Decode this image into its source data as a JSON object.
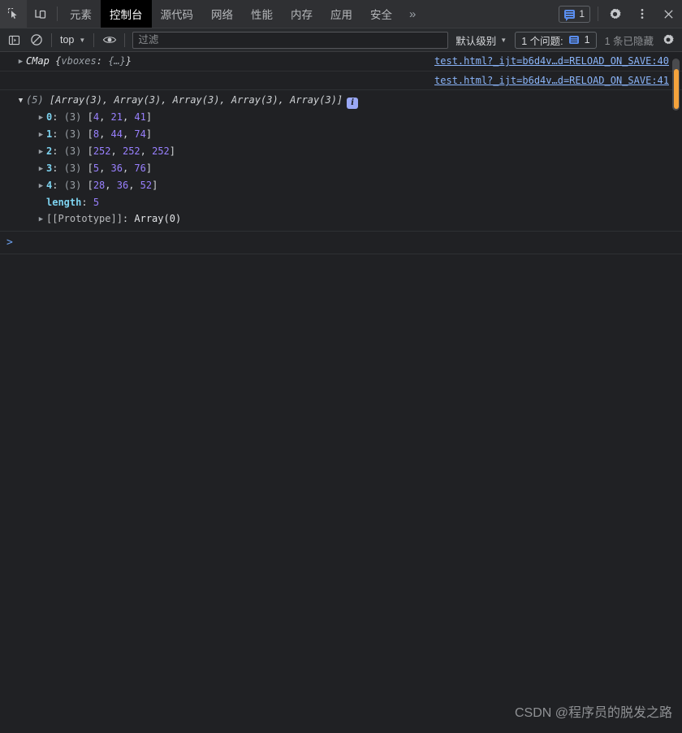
{
  "tabbar": {
    "inspect_icon": "inspect-element-icon",
    "device_icon": "device-toolbar-icon",
    "tabs": [
      {
        "label": "元素",
        "active": false
      },
      {
        "label": "控制台",
        "active": true
      },
      {
        "label": "源代码",
        "active": false
      },
      {
        "label": "网络",
        "active": false
      },
      {
        "label": "性能",
        "active": false
      },
      {
        "label": "内存",
        "active": false
      },
      {
        "label": "应用",
        "active": false
      },
      {
        "label": "安全",
        "active": false
      }
    ],
    "more_tabs": "»",
    "issues_count": "1",
    "settings_icon": "gear-icon",
    "more_icon": "kebab-menu-icon",
    "close_icon": "close-icon"
  },
  "toolbar": {
    "sidebar_icon": "console-sidebar-icon",
    "clear_icon": "clear-console-icon",
    "context": "top",
    "context_caret": "▼",
    "eye_icon": "live-expression-eye-icon",
    "filter_placeholder": "过滤",
    "filter_value": "",
    "level_label": "默认级别",
    "level_caret": "▼",
    "issue_label": "1 个问题:",
    "issue_count": "1",
    "hidden_label": "1 条已隐藏",
    "settings_icon": "console-settings-gear-icon"
  },
  "console": {
    "rows": [
      {
        "arrow": "▶",
        "name": "CMap",
        "brace_open": "{",
        "prop": "vboxes",
        "prop_sep": ": ",
        "prop_val": "{…}",
        "brace_close": "}",
        "source": "test.html?_ijt=b6d4v…d=RELOAD_ON_SAVE:40"
      },
      {
        "arrow": "",
        "source": "test.html?_ijt=b6d4v…d=RELOAD_ON_SAVE:41"
      }
    ],
    "array_header": {
      "arrow": "▼",
      "count": "(5)",
      "summary": "[Array(3), Array(3), Array(3), Array(3), Array(3)]",
      "info_badge": "i"
    },
    "array_items": [
      {
        "arrow": "▶",
        "key": "0",
        "len": "(3)",
        "values": [
          4,
          21,
          41
        ]
      },
      {
        "arrow": "▶",
        "key": "1",
        "len": "(3)",
        "values": [
          8,
          44,
          74
        ]
      },
      {
        "arrow": "▶",
        "key": "2",
        "len": "(3)",
        "values": [
          252,
          252,
          252
        ]
      },
      {
        "arrow": "▶",
        "key": "3",
        "len": "(3)",
        "values": [
          5,
          36,
          76
        ]
      },
      {
        "arrow": "▶",
        "key": "4",
        "len": "(3)",
        "values": [
          28,
          36,
          52
        ]
      }
    ],
    "length_key": "length",
    "length_value": "5",
    "proto_arrow": "▶",
    "proto_key": "[[Prototype]]",
    "proto_value": "Array(0)",
    "prompt_chevron": ">",
    "prompt_value": ""
  },
  "watermark": "CSDN @程序员的脱发之路",
  "colors": {
    "accent_blue": "#8ab4f8",
    "number_purple": "#9980ff",
    "key_cyan": "#7dd3f0",
    "warn_orange": "#f5a33c",
    "bg": "#202124",
    "toolbar_bg": "#282a2d",
    "tabbar_bg": "#2f3033"
  }
}
